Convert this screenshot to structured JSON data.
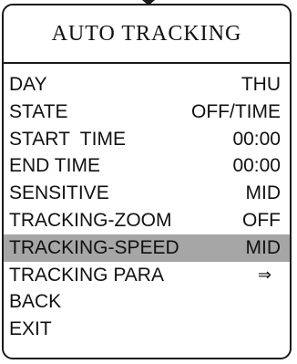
{
  "menu": {
    "title": "AUTO TRACKING",
    "colors": {
      "border": "#1a1a1a",
      "highlight": "#a6a6a6",
      "background": "#ffffff"
    },
    "rows": [
      {
        "label": "DAY",
        "value": "THU"
      },
      {
        "label": "STATE",
        "value": "OFF/TIME"
      },
      {
        "label": "START  TIME",
        "value": "00:00"
      },
      {
        "label": "END TIME",
        "value": "00:00"
      },
      {
        "label": "SENSITIVE",
        "value": "MID"
      },
      {
        "label": "TRACKING-ZOOM",
        "value": "OFF"
      },
      {
        "label": "TRACKING-SPEED",
        "value": "MID",
        "selected": true
      },
      {
        "label": "TRACKING PARA",
        "value": "⇒",
        "icon": "right-arrow-icon"
      },
      {
        "label": "BACK",
        "value": ""
      },
      {
        "label": "EXIT",
        "value": ""
      }
    ]
  }
}
